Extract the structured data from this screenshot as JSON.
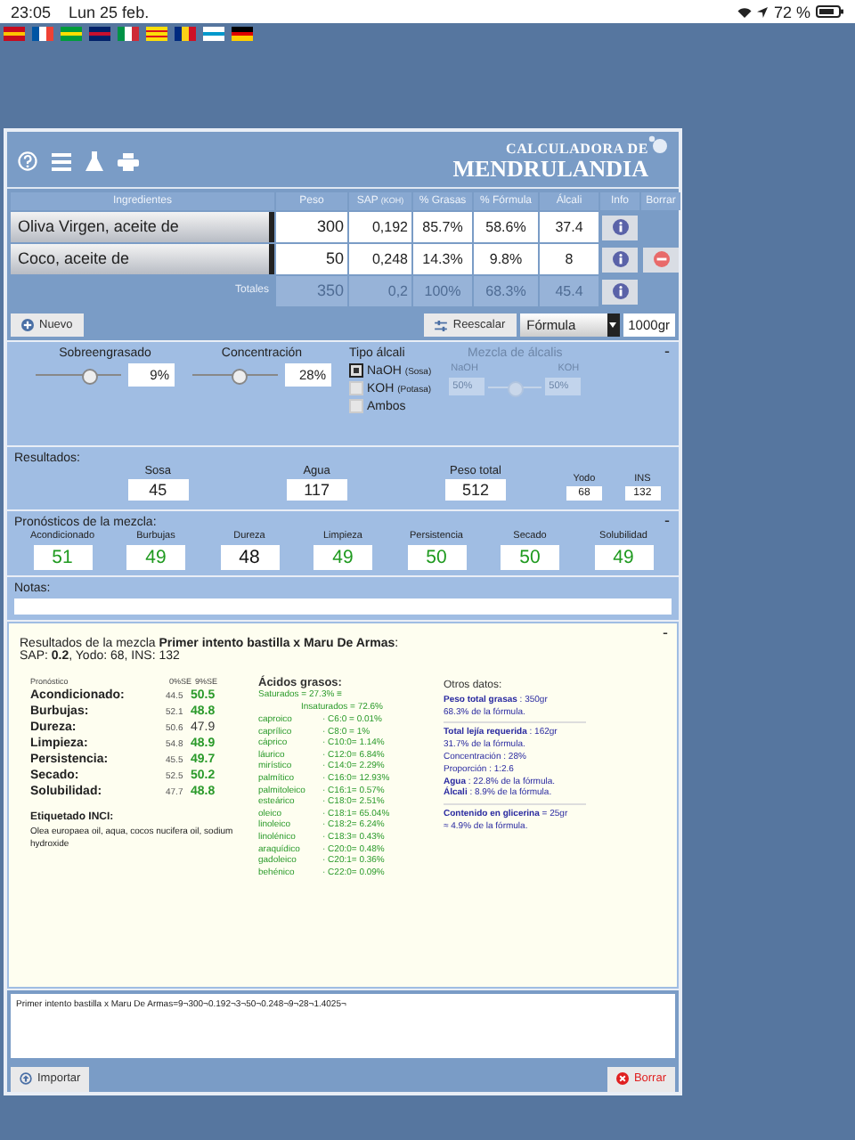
{
  "status_bar": {
    "time": "23:05",
    "date": "Lun 25 feb.",
    "battery": "72 %"
  },
  "logo": {
    "line_1": "CALCULADORA DE",
    "line_2": "MENDRULANDIA"
  },
  "table": {
    "columns": [
      "Ingredientes",
      "Peso",
      "SAP",
      "% Grasas",
      "% Fórmula",
      "Álcali",
      "Info",
      "Borrar"
    ],
    "sap_unit": "(KOH)",
    "rows": [
      {
        "name": "Oliva Virgen, aceite de",
        "peso": "300",
        "sap": "0,192",
        "grasas": "85.7%",
        "formula": "58.6%",
        "alcali": "37.4",
        "deletable": false
      },
      {
        "name": "Coco, aceite de",
        "peso": "50",
        "sap": "0,248",
        "grasas": "14.3%",
        "formula": "9.8%",
        "alcali": "8",
        "deletable": true
      }
    ],
    "totals": {
      "label": "Totales",
      "peso": "350",
      "sap": "0,2",
      "grasas": "100%",
      "formula": "68.3%",
      "alcali": "45.4"
    }
  },
  "toolbar": {
    "new_button": "Nuevo",
    "rescale_button": "Reescalar",
    "mode": "Fórmula",
    "target": "1000gr"
  },
  "settings": {
    "collapse": "-",
    "superfat": {
      "label": "Sobreengrasado",
      "level": 0.62,
      "value": "9%"
    },
    "concentration": {
      "label": "Concentración",
      "level": 0.55,
      "value": "28%"
    },
    "alkali_type": {
      "label": "Tipo álcali",
      "options": [
        {
          "label": "NaOH",
          "note": "(Sosa)",
          "selected": true
        },
        {
          "label": "KOH",
          "note": "(Potasa)",
          "selected": false
        },
        {
          "label": "Ambos",
          "selected": false
        }
      ]
    },
    "alkali_mix": {
      "label": "Mezcla de álcalis",
      "disabled": true,
      "left_label": "NaOH",
      "right_label": "KOH",
      "left_value": "50%",
      "right_value": "50%",
      "level": 0.5
    }
  },
  "results": {
    "label": "Resultados:",
    "items": [
      {
        "label": "Sosa",
        "value": "45",
        "kind": "big"
      },
      {
        "label": "Agua",
        "value": "117",
        "kind": "big"
      },
      {
        "label": "Peso total",
        "value": "512",
        "kind": "big"
      },
      {
        "label": "Yodo",
        "value": "68",
        "kind": "small"
      },
      {
        "label": "INS",
        "value": "132",
        "kind": "small"
      }
    ]
  },
  "forecast": {
    "label": "Pronósticos de la mezcla:",
    "collapse": "-",
    "items": [
      {
        "label": "Acondicionado",
        "value": "51",
        "in_range": true
      },
      {
        "label": "Burbujas",
        "value": "49",
        "in_range": true
      },
      {
        "label": "Dureza",
        "value": "48",
        "in_range": false
      },
      {
        "label": "Limpieza",
        "value": "49",
        "in_range": true
      },
      {
        "label": "Persistencia",
        "value": "50",
        "in_range": true
      },
      {
        "label": "Secado",
        "value": "50",
        "in_range": true
      },
      {
        "label": "Solubilidad",
        "value": "49",
        "in_range": true
      }
    ]
  },
  "notes": {
    "label": "Notas:"
  },
  "report": {
    "collapse": "-",
    "title": "Resultados de la mezcla **Primer intento bastilla x Maru De Armas**:",
    "summary": "SAP: **0.2**, Yodo: 68, INS: 132",
    "forecast_columns": [
      "Pronóstico",
      "0%SE",
      "9%SE"
    ],
    "forecast_rows": [
      {
        "label": "Acondicionado:",
        "base": "44.5",
        "value": "50.5",
        "in_range": true
      },
      {
        "label": "Burbujas:",
        "base": "52.1",
        "value": "48.8",
        "in_range": true
      },
      {
        "label": "Dureza:",
        "base": "50.6",
        "value": "47.9",
        "in_range": false
      },
      {
        "label": "Limpieza:",
        "base": "54.8",
        "value": "48.9",
        "in_range": true
      },
      {
        "label": "Persistencia:",
        "base": "45.5",
        "value": "49.7",
        "in_range": true
      },
      {
        "label": "Secado:",
        "base": "52.5",
        "value": "50.2",
        "in_range": true
      },
      {
        "label": "Solubilidad:",
        "base": "47.7",
        "value": "48.8",
        "in_range": true
      }
    ],
    "inci_label": "Etiquetado INCI:",
    "inci_text": "Olea europaea oil, aqua, cocos nucifera oil, sodium hydroxide",
    "acids_label": "Ácidos grasos:",
    "saturated": "Saturados = 27.3% ≡",
    "unsaturated": "Insaturados = 72.6%",
    "acids": [
      {
        "name": "caproico",
        "value": "· C6:0 = 0.01%"
      },
      {
        "name": "caprílico",
        "value": "· C8:0 = 1%"
      },
      {
        "name": "cáprico",
        "value": "· C10:0= 1.14%"
      },
      {
        "name": "láurico",
        "value": "· C12:0= 6.84%"
      },
      {
        "name": "mirístico",
        "value": "· C14:0= 2.29%"
      },
      {
        "name": "palmítico",
        "value": "· C16:0= 12.93%"
      },
      {
        "name": "palmitoleico",
        "value": "· C16:1= 0.57%"
      },
      {
        "name": "esteárico",
        "value": "· C18:0= 2.51%"
      },
      {
        "name": "oleico",
        "value": "· C18:1= 65.04%"
      },
      {
        "name": "linoleico",
        "value": "· C18:2= 6.24%"
      },
      {
        "name": "linolénico",
        "value": "· C18:3= 0.43%"
      },
      {
        "name": "araquídico",
        "value": "· C20:0= 0.48%"
      },
      {
        "name": "gadoleico",
        "value": "· C20:1= 0.36%"
      },
      {
        "name": "behénico",
        "value": "· C22:0= 0.09%"
      }
    ],
    "other_label": "Otros datos:",
    "other_groups": [
      [
        "**Peso total grasas** : 350gr",
        "68.3% de la fórmula."
      ],
      [
        "**Total lejía requerida** : 162gr",
        "31.7% de la fórmula.",
        "Concentración : 28%",
        "Proporción : 1:2.6",
        "**Agua** : 22.8% de la fórmula.",
        "**Álcali** : 8.9% de la fórmula."
      ],
      [
        "**Contenido en glicerina** = 25gr",
        "≈ 4.9% de la fórmula."
      ]
    ]
  },
  "export_text": "Primer intento bastilla x Maru De Armas=9¬300¬0.192¬3¬50¬0.248¬9¬28¬1.4025¬",
  "bottom_buttons": {
    "import": "Importar",
    "clear": "Borrar"
  }
}
